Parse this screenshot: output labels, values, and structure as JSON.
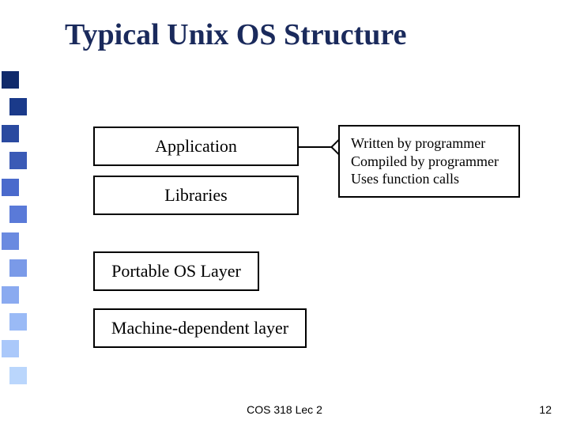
{
  "title": "Typical Unix OS Structure",
  "boxes": {
    "application": "Application",
    "libraries": "Libraries",
    "portable": "Portable OS Layer",
    "machine": "Machine-dependent layer"
  },
  "callout": {
    "line1": "Written by programmer",
    "line2": "Compiled by programmer",
    "line3": "Uses function calls"
  },
  "footer": {
    "center": "COS 318 Lec 2",
    "page": "12"
  },
  "sidebar_colors": [
    "#102a6b",
    "#1a3a8a",
    "#2a4aa0",
    "#3a5ab6",
    "#4a6acc",
    "#5a7ad8",
    "#6a8ae0",
    "#7a9ae8",
    "#8aaaf0",
    "#9abaf6",
    "#aac8fa",
    "#bad6fc"
  ]
}
